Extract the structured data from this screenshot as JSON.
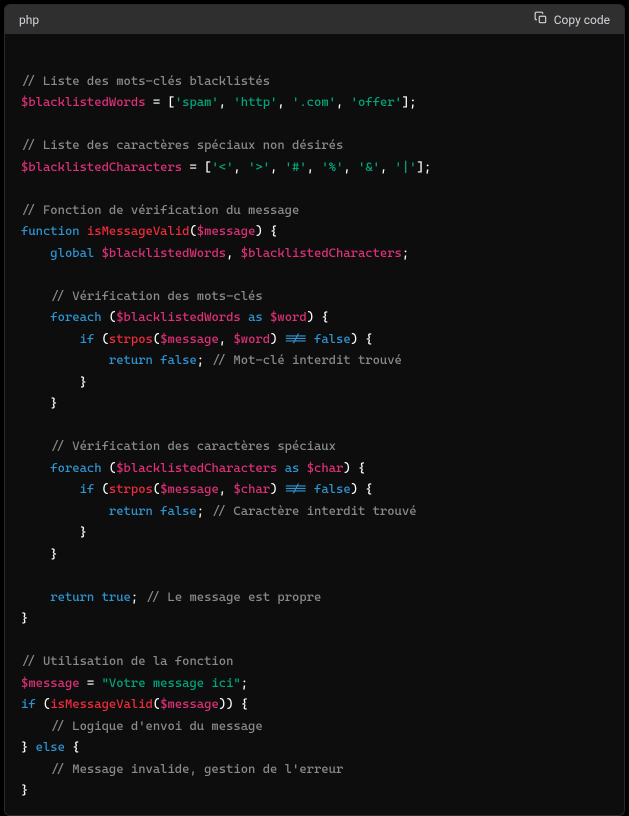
{
  "header": {
    "language": "php",
    "copy_label": "Copy code"
  },
  "code": {
    "comments": {
      "c1": "// Liste des mots-clés blacklistés",
      "c2": "// Liste des caractères spéciaux non désirés",
      "c3": "// Fonction de vérification du message",
      "c4": "// Vérification des mots-clés",
      "c5": "// Mot-clé interdit trouvé",
      "c6": "// Vérification des caractères spéciaux",
      "c7": "// Caractère interdit trouvé",
      "c8": "// Le message est propre",
      "c9": "// Utilisation de la fonction",
      "c10": "// Logique d'envoi du message",
      "c11": "// Message invalide, gestion de l'erreur"
    },
    "vars": {
      "blacklistedWords": "$blacklistedWords",
      "blacklistedCharacters": "$blacklistedCharacters",
      "message": "$message",
      "word": "$word",
      "char": "$char"
    },
    "strings": {
      "spam": "'spam'",
      "http": "'http'",
      "dotcom": "'.com'",
      "offer": "'offer'",
      "lt": "'<'",
      "gt": "'>'",
      "hash": "'#'",
      "pct": "'%'",
      "amp": "'&'",
      "pipe": "'|'",
      "yourmsg": "\"Votre message ici\""
    },
    "keywords": {
      "function": "function",
      "global": "global",
      "foreach": "foreach",
      "as": "as",
      "if": "if",
      "return": "return",
      "else": "else",
      "false": "false",
      "true": "true",
      "neq": "!=="
    },
    "functions": {
      "isMessageValid": "isMessageValid",
      "strpos": "strpos"
    }
  },
  "chart_data": null
}
